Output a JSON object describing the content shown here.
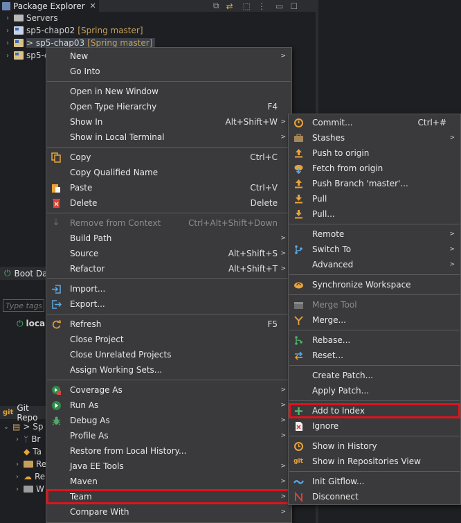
{
  "explorer": {
    "tab_title": "Package Explorer",
    "tree": [
      {
        "label": "Servers",
        "branch": ""
      },
      {
        "label": "sp5-chap02",
        "branch": "[Spring master]"
      },
      {
        "label": "> sp5-chap03",
        "branch": "[Spring master]"
      },
      {
        "label": "sp5-c",
        "branch": ""
      }
    ]
  },
  "boot_dashboard": {
    "title": "Boot Da",
    "filter_placeholder": "Type tags,",
    "local_label": "loca"
  },
  "git_repos": {
    "title": "Git Repo",
    "rows": [
      "> Sp",
      "Br",
      "Ta",
      "Re",
      "Re",
      "W"
    ]
  },
  "context_menu": {
    "items": [
      {
        "label": "New",
        "submenu": true
      },
      {
        "label": "Go Into"
      },
      {
        "sep": true
      },
      {
        "label": "Open in New Window"
      },
      {
        "label": "Open Type Hierarchy",
        "accel": "F4"
      },
      {
        "label": "Show In",
        "accel": "Alt+Shift+W",
        "submenu": true
      },
      {
        "label": "Show in Local Terminal",
        "submenu": true
      },
      {
        "sep": true
      },
      {
        "label": "Copy",
        "accel": "Ctrl+C",
        "icon": "copy-icon"
      },
      {
        "label": "Copy Qualified Name"
      },
      {
        "label": "Paste",
        "accel": "Ctrl+V",
        "icon": "paste-icon"
      },
      {
        "label": "Delete",
        "accel": "Delete",
        "icon": "delete-icon"
      },
      {
        "sep": true
      },
      {
        "label": "Remove from Context",
        "accel": "Ctrl+Alt+Shift+Down",
        "disabled": true,
        "icon": "remove-context-icon"
      },
      {
        "label": "Build Path",
        "submenu": true
      },
      {
        "label": "Source",
        "accel": "Alt+Shift+S",
        "submenu": true
      },
      {
        "label": "Refactor",
        "accel": "Alt+Shift+T",
        "submenu": true
      },
      {
        "sep": true
      },
      {
        "label": "Import...",
        "icon": "import-icon"
      },
      {
        "label": "Export...",
        "icon": "export-icon"
      },
      {
        "sep": true
      },
      {
        "label": "Refresh",
        "accel": "F5",
        "icon": "refresh-icon"
      },
      {
        "label": "Close Project"
      },
      {
        "label": "Close Unrelated Projects"
      },
      {
        "label": "Assign Working Sets..."
      },
      {
        "sep": true
      },
      {
        "label": "Coverage As",
        "submenu": true,
        "icon": "coverage-icon"
      },
      {
        "label": "Run As",
        "submenu": true,
        "icon": "run-icon"
      },
      {
        "label": "Debug As",
        "submenu": true,
        "icon": "debug-icon"
      },
      {
        "label": "Profile As",
        "submenu": true
      },
      {
        "label": "Restore from Local History..."
      },
      {
        "label": "Java EE Tools",
        "submenu": true
      },
      {
        "label": "Maven",
        "submenu": true
      },
      {
        "label": "Team",
        "submenu": true,
        "highlighted": true
      },
      {
        "label": "Compare With",
        "submenu": true
      }
    ]
  },
  "team_menu": {
    "items": [
      {
        "label": "Commit...",
        "accel": "Ctrl+#",
        "icon": "commit-icon"
      },
      {
        "label": "Stashes",
        "submenu": true,
        "icon": "stash-icon"
      },
      {
        "label": "Push to origin",
        "icon": "push-icon"
      },
      {
        "label": "Fetch from origin",
        "icon": "fetch-icon"
      },
      {
        "label": "Push Branch 'master'...",
        "icon": "push-branch-icon"
      },
      {
        "label": "Pull",
        "icon": "pull-icon"
      },
      {
        "label": "Pull...",
        "icon": "pull-dialog-icon"
      },
      {
        "sep": true
      },
      {
        "label": "Remote",
        "submenu": true
      },
      {
        "label": "Switch To",
        "submenu": true,
        "icon": "switch-branch-icon"
      },
      {
        "label": "Advanced",
        "submenu": true
      },
      {
        "sep": true
      },
      {
        "label": "Synchronize Workspace",
        "icon": "synchronize-icon"
      },
      {
        "sep": true
      },
      {
        "label": "Merge Tool",
        "disabled": true,
        "icon": "merge-tool-icon"
      },
      {
        "label": "Merge...",
        "icon": "merge-icon"
      },
      {
        "sep": true
      },
      {
        "label": "Rebase...",
        "icon": "rebase-icon"
      },
      {
        "label": "Reset...",
        "icon": "reset-icon"
      },
      {
        "sep": true
      },
      {
        "label": "Create Patch..."
      },
      {
        "label": "Apply Patch..."
      },
      {
        "sep": true
      },
      {
        "label": "Add to Index",
        "highlighted": true,
        "icon": "add-to-index-icon"
      },
      {
        "label": "Ignore",
        "icon": "ignore-icon"
      },
      {
        "sep": true
      },
      {
        "label": "Show in History",
        "icon": "history-icon"
      },
      {
        "label": "Show in Repositories View",
        "icon": "repositories-icon"
      },
      {
        "sep": true
      },
      {
        "label": "Init Gitflow...",
        "icon": "gitflow-icon"
      },
      {
        "label": "Disconnect",
        "icon": "disconnect-icon"
      }
    ]
  },
  "colors": {
    "menu_bg": "#3a3a3c",
    "highlight_border": "#e0121c",
    "git_orange": "#e8a43a",
    "disabled_text": "#8c8c8c"
  }
}
